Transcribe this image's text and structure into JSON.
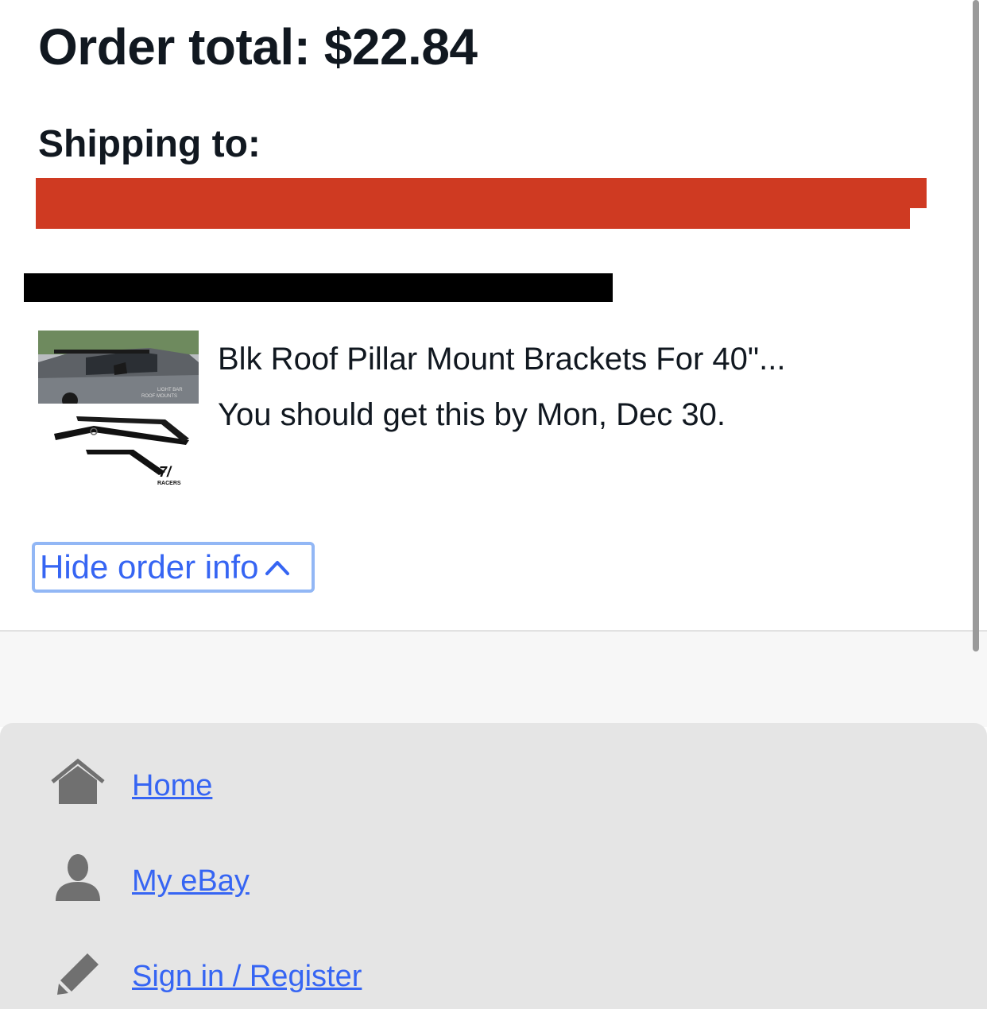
{
  "order": {
    "total_label": "Order total: $22.84",
    "shipping_label": "Shipping to:"
  },
  "item": {
    "title": "Blk Roof Pillar Mount Brackets For 40\"...",
    "delivery": "You should get this by Mon, Dec 30.",
    "thumb_text_1": "LIGHT BAR",
    "thumb_text_2": "ROOF MOUNTS",
    "thumb_brand": "RACERS"
  },
  "toggle": {
    "label": "Hide order info"
  },
  "footer_nav": {
    "items": [
      {
        "label": "Home",
        "icon": "home-icon"
      },
      {
        "label": "My eBay",
        "icon": "user-icon"
      },
      {
        "label": "Sign in / Register",
        "icon": "pencil-icon"
      }
    ]
  },
  "colors": {
    "link": "#3665f3",
    "focus_ring": "#92b7f5",
    "redaction_red": "#cf3a22",
    "footer_bg": "#e5e5e5",
    "icon_gray": "#707070"
  }
}
